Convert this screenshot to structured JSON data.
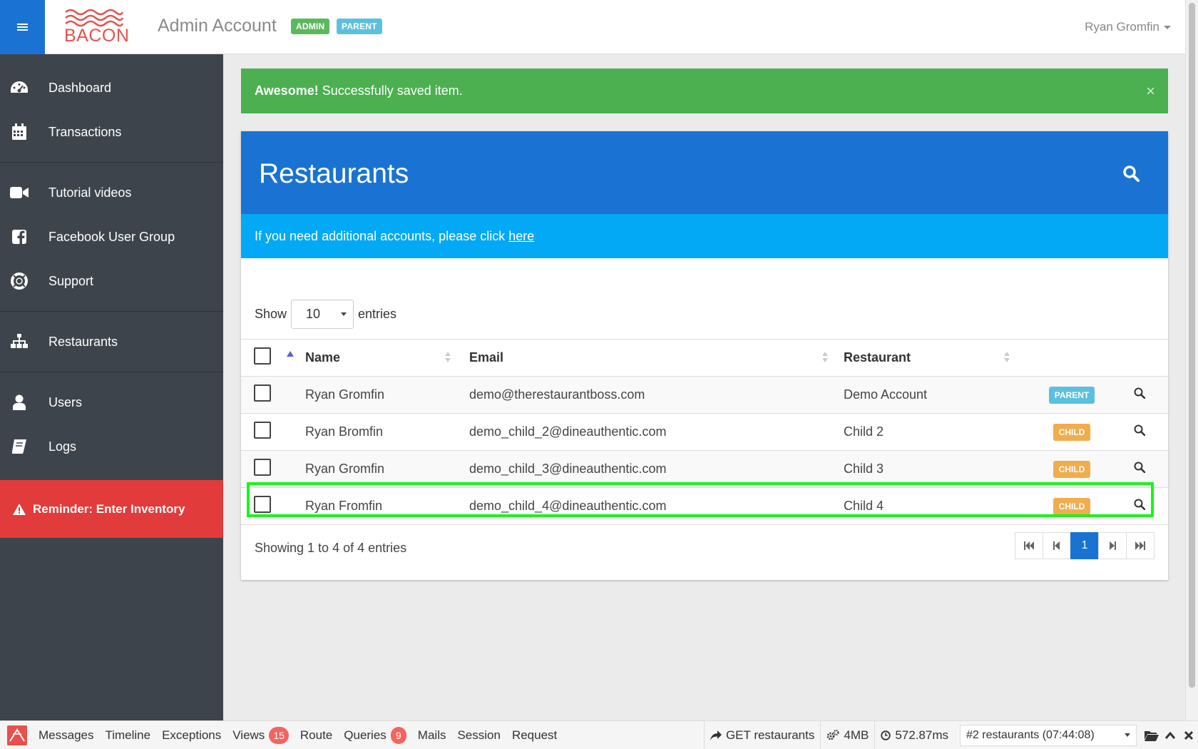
{
  "header": {
    "logo_text": "BACON",
    "account_title": "Admin Account",
    "badge_admin": "ADMIN",
    "badge_parent": "PARENT",
    "user_name": "Ryan Gromfin"
  },
  "sidebar": {
    "items": [
      {
        "label": "Dashboard",
        "icon": "dashboard-icon"
      },
      {
        "label": "Transactions",
        "icon": "calendar-icon"
      },
      {
        "label": "Tutorial videos",
        "icon": "video-camera-icon"
      },
      {
        "label": "Facebook User Group",
        "icon": "facebook-icon"
      },
      {
        "label": "Support",
        "icon": "life-ring-icon"
      },
      {
        "label": "Restaurants",
        "icon": "sitemap-icon"
      },
      {
        "label": "Users",
        "icon": "user-icon"
      },
      {
        "label": "Logs",
        "icon": "book-icon"
      }
    ],
    "reminder": "Reminder: Enter Inventory"
  },
  "alert": {
    "strong": "Awesome!",
    "message": "Successfully saved item.",
    "close": "×"
  },
  "card": {
    "title": "Restaurants",
    "info_text": "If you need additional accounts, please click",
    "info_link": "here"
  },
  "table": {
    "show_label": "Show",
    "entries_label": "entries",
    "page_length": "10",
    "columns": [
      "Name",
      "Email",
      "Restaurant"
    ],
    "rows": [
      {
        "name": "Ryan Gromfin",
        "email": "demo@therestaurantboss.com",
        "restaurant": "Demo Account",
        "type": "PARENT"
      },
      {
        "name": "Ryan Bromfin",
        "email": "demo_child_2@dineauthentic.com",
        "restaurant": "Child 2",
        "type": "CHILD"
      },
      {
        "name": "Ryan Gromfin",
        "email": "demo_child_3@dineauthentic.com",
        "restaurant": "Child 3",
        "type": "CHILD"
      },
      {
        "name": "Ryan Fromfin",
        "email": "demo_child_4@dineauthentic.com",
        "restaurant": "Child 4",
        "type": "CHILD"
      }
    ],
    "info": "Showing 1 to 4 of 4 entries",
    "current_page": "1"
  },
  "debugbar": {
    "tabs": [
      "Messages",
      "Timeline",
      "Exceptions",
      "Views",
      "Route",
      "Queries",
      "Mails",
      "Session",
      "Request"
    ],
    "views_count": "15",
    "queries_count": "9",
    "route": "GET restaurants",
    "memory": "4MB",
    "time": "572.87ms",
    "request_select": "#2 restaurants (07:44:08)"
  },
  "colors": {
    "primary": "#1a73d2",
    "sidebar": "#3e444c",
    "success": "#4caf50",
    "info_bar": "#03a9f4",
    "reminder": "#e23b3b",
    "highlight": "#19f519"
  }
}
